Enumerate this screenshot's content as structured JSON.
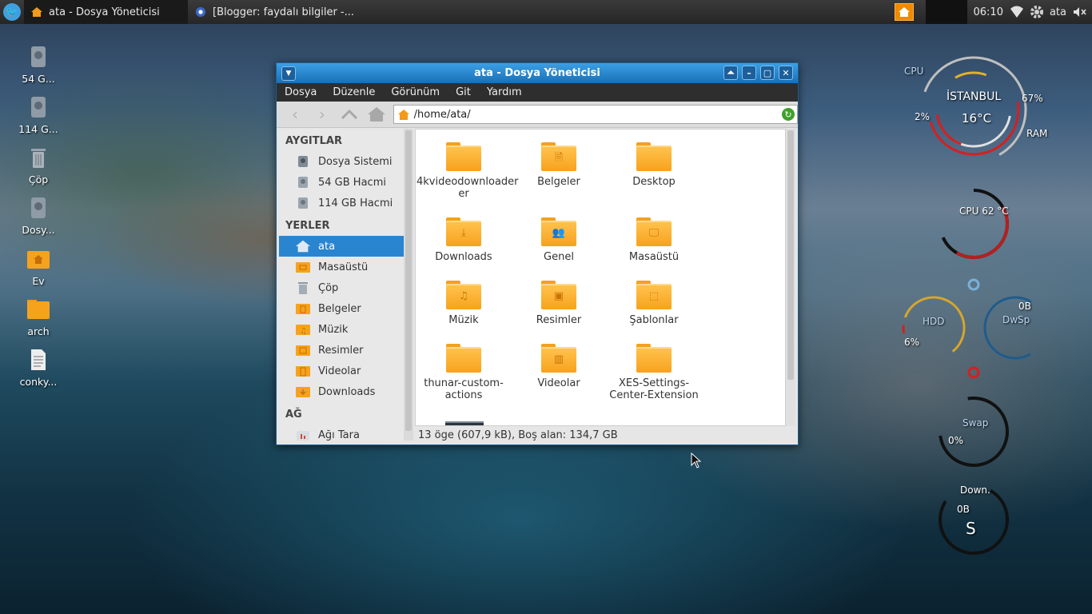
{
  "panel": {
    "tasks": [
      {
        "label": "ata - Dosya Yöneticisi"
      },
      {
        "label": "[Blogger: faydalı bilgiler -..."
      }
    ],
    "clock": "06:10",
    "user": "ata"
  },
  "desktop_icons": [
    {
      "label": "54 G..."
    },
    {
      "label": "114 G..."
    },
    {
      "label": "Çöp"
    },
    {
      "label": "Dosy..."
    },
    {
      "label": "Ev"
    },
    {
      "label": "arch"
    },
    {
      "label": "conky..."
    }
  ],
  "window": {
    "title": "ata - Dosya Yöneticisi",
    "menu": [
      "Dosya",
      "Düzenle",
      "Görünüm",
      "Git",
      "Yardım"
    ],
    "location": "/home/ata/",
    "sidebar": {
      "devices_header": "AYGITLAR",
      "devices": [
        "Dosya Sistemi",
        "54 GB Hacmi",
        "114 GB Hacmi"
      ],
      "places_header": "YERLER",
      "places": [
        "ata",
        "Masaüstü",
        "Çöp",
        "Belgeler",
        "Müzik",
        "Resimler",
        "Videolar",
        "Downloads"
      ],
      "network_header": "AĞ",
      "network": [
        "Ağı Tara"
      ]
    },
    "files": [
      {
        "name": "4kvideodownloader",
        "name2": "er",
        "icon": "folder"
      },
      {
        "name": "Belgeler",
        "name2": "",
        "icon": "document-folder"
      },
      {
        "name": "Desktop",
        "name2": "",
        "icon": "folder"
      },
      {
        "name": "Downloads",
        "name2": "",
        "icon": "download-folder"
      },
      {
        "name": "Genel",
        "name2": "",
        "icon": "people-folder"
      },
      {
        "name": "Masaüstü",
        "name2": "",
        "icon": "desktop-folder"
      },
      {
        "name": "Müzik",
        "name2": "",
        "icon": "music-folder"
      },
      {
        "name": "Resimler",
        "name2": "",
        "icon": "picture-folder"
      },
      {
        "name": "Şablonlar",
        "name2": "",
        "icon": "template-folder"
      },
      {
        "name": "thunar-custom-",
        "name2": "actions",
        "icon": "folder"
      },
      {
        "name": "Videolar",
        "name2": "",
        "icon": "video-folder"
      },
      {
        "name": "XES-Settings-",
        "name2": "Center-Extension",
        "icon": "folder"
      }
    ],
    "status": "13 öge (607,9 kB), Boş alan: 134,7 GB"
  },
  "conky": {
    "cpu_label": "CPU",
    "city": "İSTANBUL",
    "temp": "16°C",
    "cpu_pct": "2%",
    "ram_pct": "67%",
    "ram_label": "RAM",
    "cpu_temp": "CPU 62 °C",
    "hdd_label": "HDD",
    "hdd_pct": "6%",
    "dwsp_val": "0B",
    "dwsp_label": "DwSp",
    "swap_label": "Swap",
    "swap_pct": "0%",
    "down_label": "Down.",
    "down_val": "0B",
    "down_unit": "S"
  }
}
